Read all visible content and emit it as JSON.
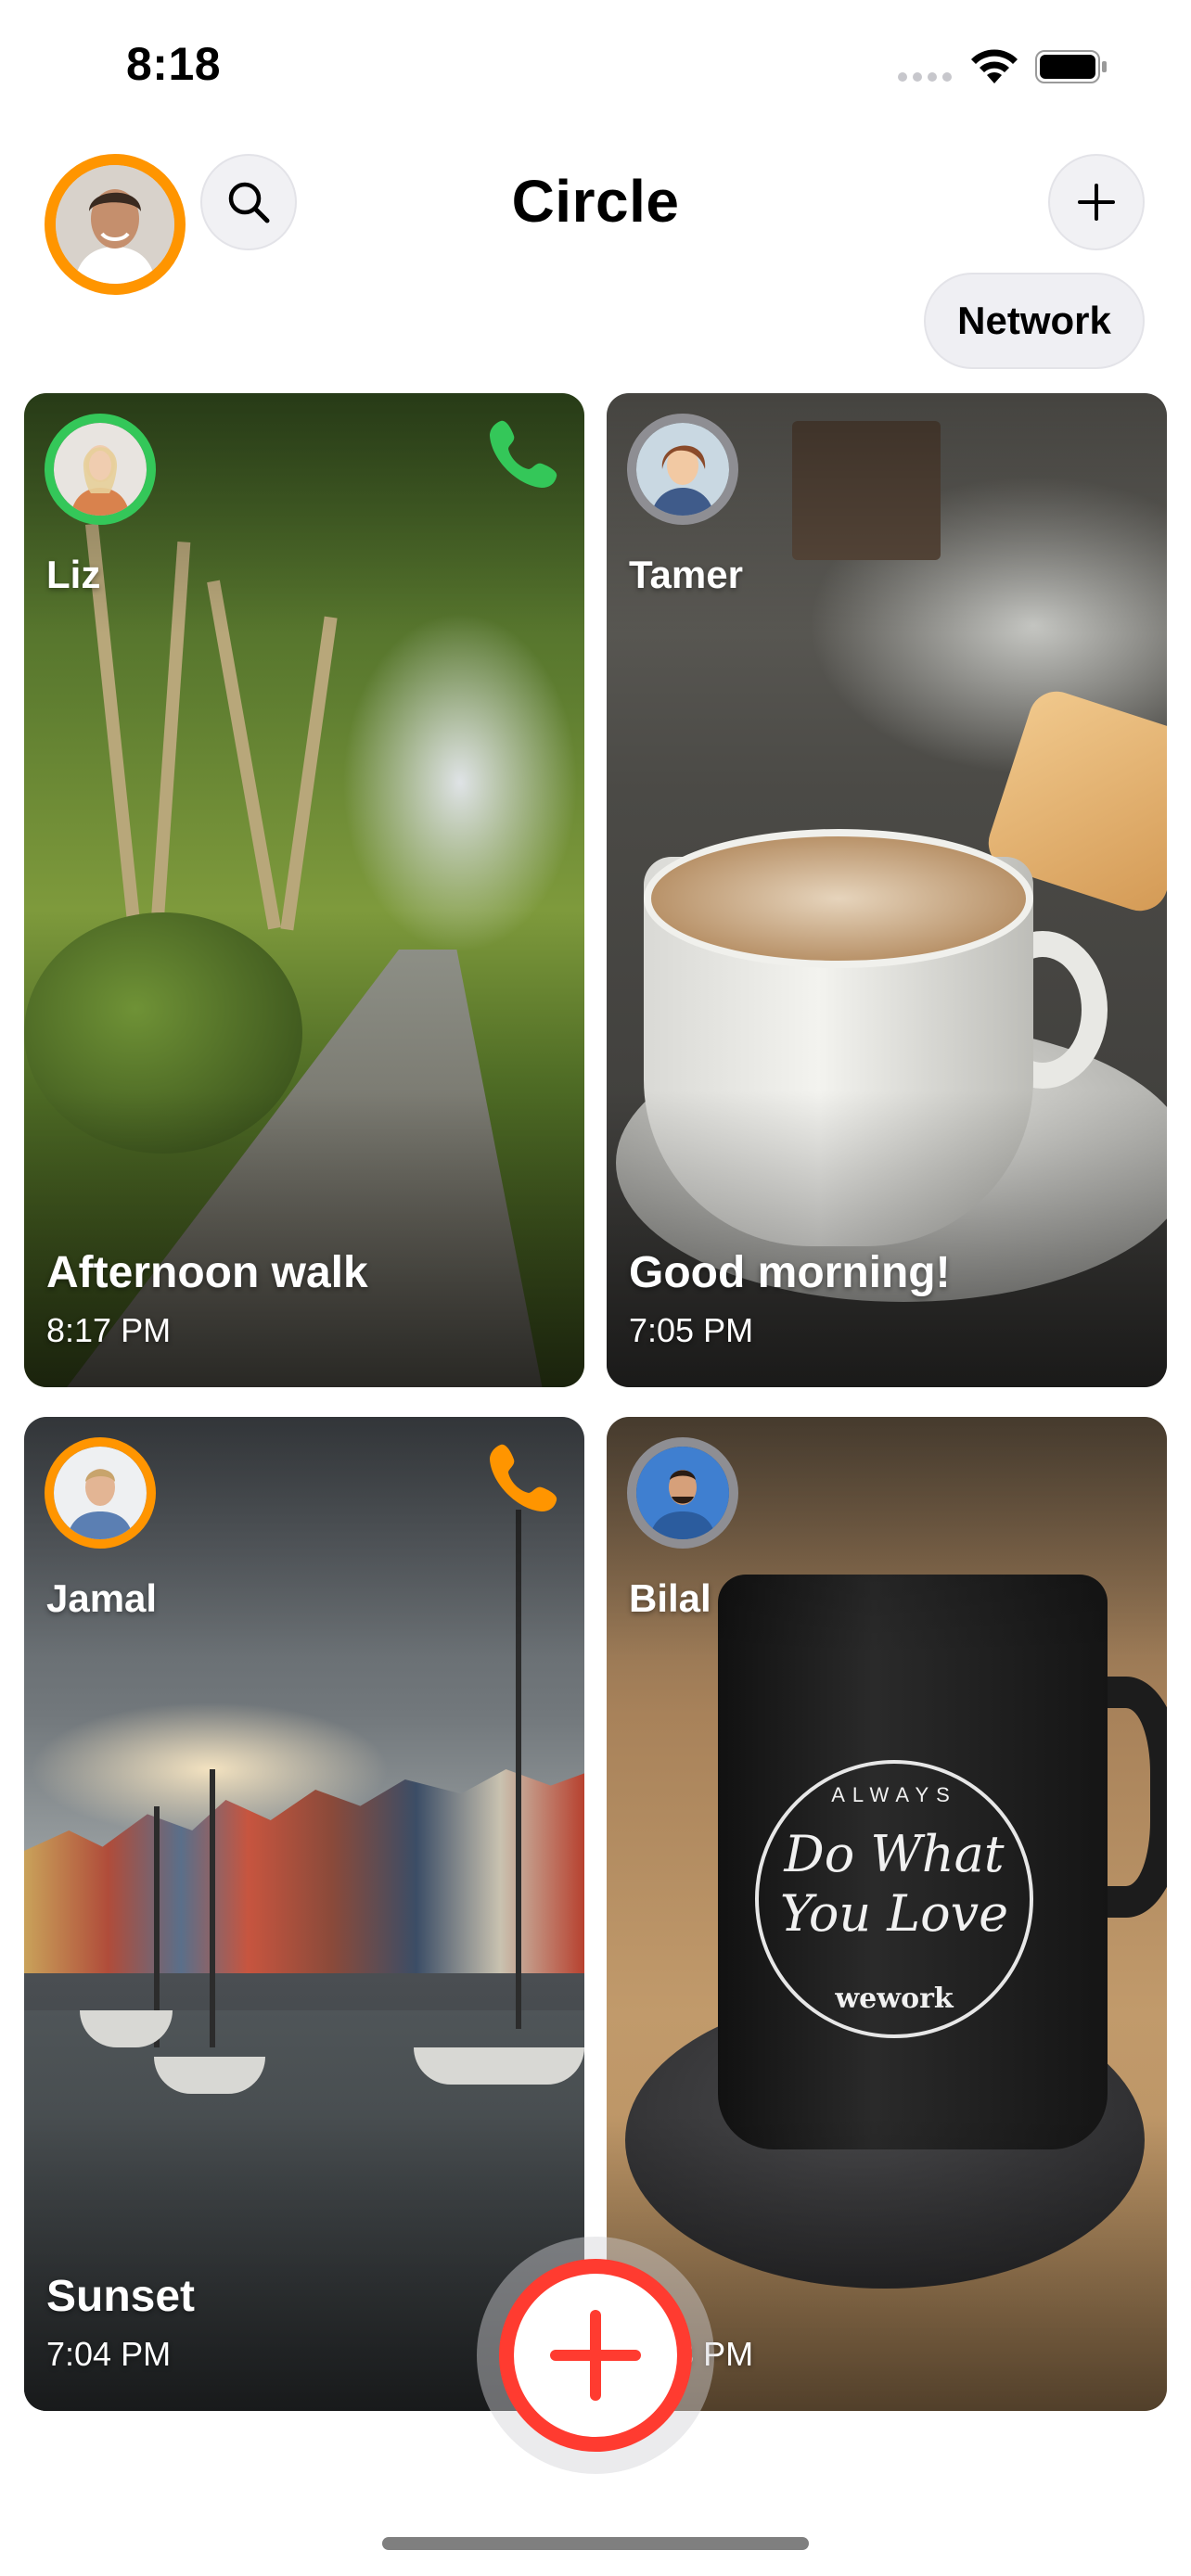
{
  "status_bar": {
    "time": "8:18"
  },
  "header": {
    "title": "Circle",
    "network_label": "Network",
    "search_icon": "search-icon",
    "add_icon": "plus-icon"
  },
  "colors": {
    "accent_orange": "#ff9500",
    "accent_green": "#34c759",
    "accent_red": "#ff3b30"
  },
  "cards": [
    {
      "name": "Liz",
      "caption": "Afternoon walk",
      "time": "8:17 PM",
      "ring": "green",
      "call_icon": "phone-icon-green"
    },
    {
      "name": "Tamer",
      "caption": "Good morning!",
      "time": "7:05 PM",
      "ring": "gray"
    },
    {
      "name": "Jamal",
      "caption": "Sunset",
      "time": "7:04 PM",
      "ring": "orange",
      "call_icon": "phone-icon-orange"
    },
    {
      "name": "Bilal",
      "caption": "",
      "time": "7:03 PM",
      "ring": "gray"
    }
  ],
  "mug_print": {
    "top": "ALWAYS",
    "line1": "Do What",
    "line2": "You Love",
    "brand": "wework"
  },
  "fab": {
    "icon": "plus-icon"
  }
}
